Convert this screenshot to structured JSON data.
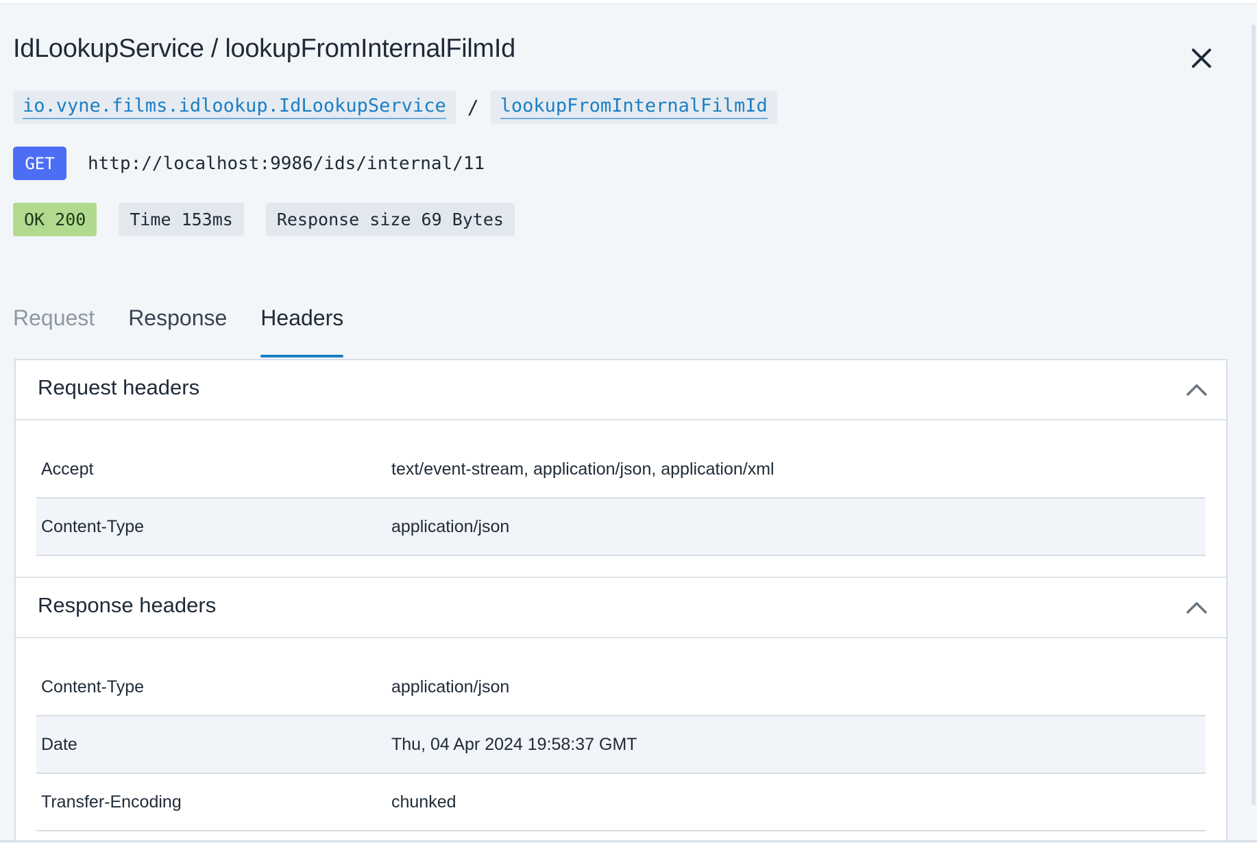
{
  "title": "IdLookupService / lookupFromInternalFilmId",
  "breadcrumb": {
    "service": "io.vyne.films.idlookup.IdLookupService",
    "separator": "/",
    "operation": "lookupFromInternalFilmId"
  },
  "request_line": {
    "method": "GET",
    "url": "http://localhost:9986/ids/internal/11"
  },
  "stats": {
    "status": "OK 200",
    "time": "Time 153ms",
    "size": "Response size 69 Bytes"
  },
  "tabs": [
    {
      "label": "Request",
      "state": "dim"
    },
    {
      "label": "Response",
      "state": "normal"
    },
    {
      "label": "Headers",
      "state": "active"
    }
  ],
  "request_headers": {
    "title": "Request headers",
    "rows": [
      {
        "key": "Accept",
        "value": "text/event-stream, application/json, application/xml"
      },
      {
        "key": "Content-Type",
        "value": "application/json"
      }
    ]
  },
  "response_headers": {
    "title": "Response headers",
    "rows": [
      {
        "key": "Content-Type",
        "value": "application/json"
      },
      {
        "key": "Date",
        "value": "Thu, 04 Apr 2024 19:58:37 GMT"
      },
      {
        "key": "Transfer-Encoding",
        "value": "chunked"
      }
    ]
  },
  "colors": {
    "accent": "#1a7fc4",
    "method_badge": "#4c6ef5",
    "ok_badge": "#b2da8f",
    "panel_bg": "#f3f6f9"
  },
  "icons": {
    "close": "close-icon",
    "collapse": "chevron-up-icon"
  }
}
